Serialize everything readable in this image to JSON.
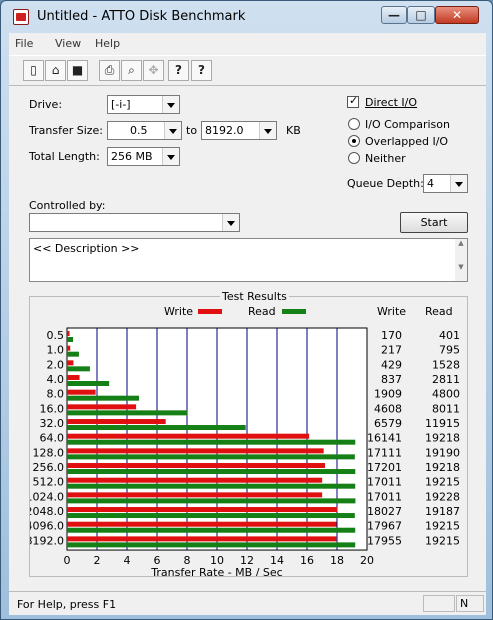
{
  "window": {
    "title": "Untitled - ATTO Disk Benchmark",
    "min": "—",
    "max": "□",
    "close": "✕"
  },
  "menu": [
    "File",
    "View",
    "Help"
  ],
  "toolbar": [
    "new-icon",
    "open-icon",
    "save-icon",
    "print-icon",
    "print-preview-icon",
    "move-icon",
    "help-icon",
    "context-help-icon"
  ],
  "form": {
    "drive_label": "Drive:",
    "drive_value": "[-i-]",
    "transfer_size_label": "Transfer Size:",
    "transfer_from": "0.5",
    "to_label": "to",
    "transfer_to": "8192.0",
    "kb_label": "KB",
    "total_length_label": "Total Length:",
    "total_length_value": "256 MB",
    "direct_io_label": "Direct I/O",
    "io_comparison_label": "I/O Comparison",
    "overlapped_io_label": "Overlapped I/O",
    "neither_label": "Neither",
    "queue_depth_label": "Queue Depth:",
    "queue_depth_value": "4",
    "controlled_by_label": "Controlled by:",
    "controlled_by_value": "",
    "start_label": "Start",
    "description": "<< Description >>"
  },
  "results": {
    "group_title": "Test Results",
    "legend_write": "Write",
    "legend_read": "Read",
    "col_write": "Write",
    "col_read": "Read",
    "write_color": "#e01010",
    "read_color": "#158015"
  },
  "chart_data": {
    "type": "bar",
    "orientation": "horizontal",
    "categories": [
      "0.5",
      "1.0",
      "2.0",
      "4.0",
      "8.0",
      "16.0",
      "32.0",
      "64.0",
      "128.0",
      "256.0",
      "512.0",
      "1024.0",
      "2048.0",
      "4096.0",
      "8192.0"
    ],
    "series": [
      {
        "name": "Write",
        "values": [
          170,
          217,
          429,
          837,
          1909,
          4608,
          6579,
          16141,
          17111,
          17201,
          17011,
          17011,
          18027,
          17967,
          17955
        ]
      },
      {
        "name": "Read",
        "values": [
          401,
          795,
          1528,
          2811,
          4800,
          8011,
          11915,
          19218,
          19190,
          19218,
          19215,
          19228,
          19187,
          19215,
          19215
        ]
      }
    ],
    "xlabel": "Transfer Rate - MB / Sec",
    "xticks": [
      "0",
      "2",
      "4",
      "6",
      "8",
      "10",
      "12",
      "14",
      "16",
      "18",
      "20"
    ],
    "xlim": [
      0,
      20
    ],
    "grid": true,
    "legend": "top"
  },
  "statusbar": {
    "text": "For Help, press F1",
    "indicator": "N"
  }
}
